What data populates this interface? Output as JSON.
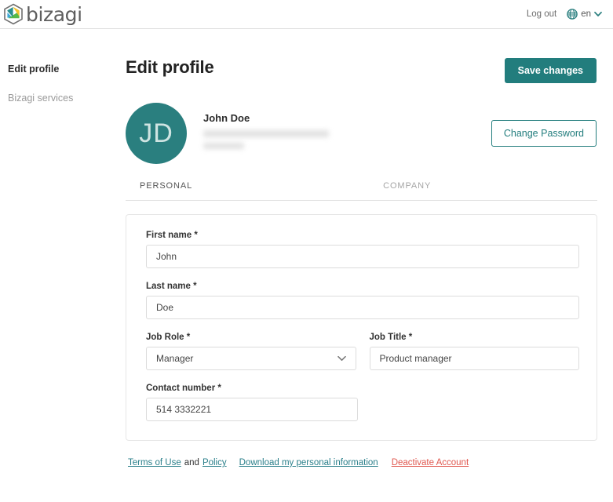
{
  "brand": {
    "name": "bizagi",
    "logo_icon": "bizagi-hexagon-logo",
    "teal": "#227d7d",
    "accent_green": "#4caf50",
    "accent_blue": "#1f8fc4",
    "accent_yellow": "#f2c230"
  },
  "topbar": {
    "logout_label": "Log out",
    "globe_icon": "globe-icon",
    "language_code": "en",
    "caret_icon": "chevron-down-icon"
  },
  "sidebar": {
    "items": [
      {
        "label": "Edit profile",
        "active": true
      },
      {
        "label": "Bizagi services",
        "active": false
      }
    ]
  },
  "header": {
    "title": "Edit profile",
    "save_label": "Save changes"
  },
  "profile": {
    "initials": "JD",
    "name": "John Doe",
    "email_redacted": true,
    "phone_redacted": true,
    "change_password_label": "Change Password"
  },
  "tabs": [
    {
      "label": "PERSONAL",
      "active": true
    },
    {
      "label": "COMPANY",
      "active": false
    }
  ],
  "form": {
    "first_name": {
      "label": "First name",
      "required": "*",
      "value": "John"
    },
    "last_name": {
      "label": "Last name",
      "required": "*",
      "value": "Doe"
    },
    "job_role": {
      "label": "Job Role",
      "required": "*",
      "value": "Manager",
      "caret_icon": "chevron-down-icon"
    },
    "job_title": {
      "label": "Job Title",
      "required": "*",
      "value": "Product manager"
    },
    "contact_number": {
      "label": "Contact number",
      "required": "*",
      "value": "514 3332221"
    }
  },
  "footer": {
    "terms_label": "Terms of Use",
    "and_label": "and",
    "policy_label": "Policy",
    "download_label": "Download my personal information",
    "deactivate_label": "Deactivate Account",
    "danger_color": "#e0584f"
  }
}
